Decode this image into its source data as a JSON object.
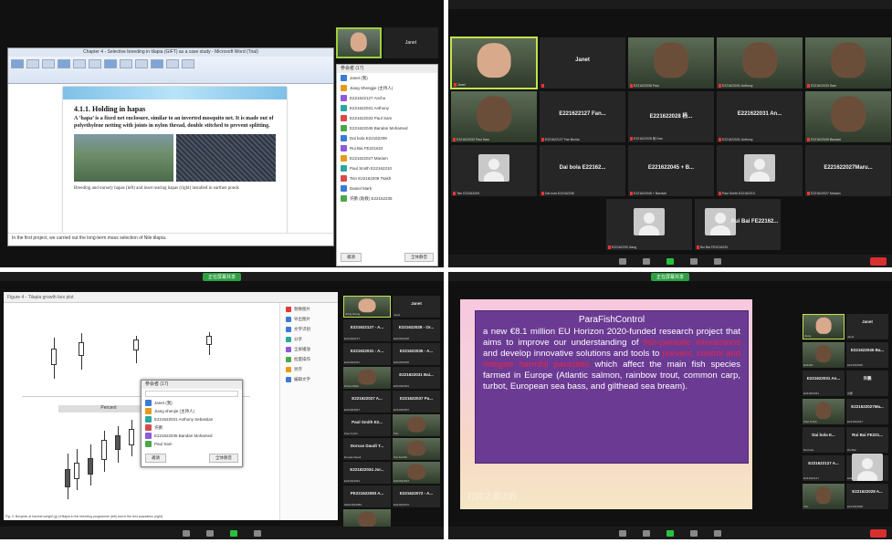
{
  "q1": {
    "word_title": "Chapter 4 - Selective breeding in tilapia (GIFT) as a case study - Microsoft Word (Trial)",
    "doc_heading": "4.1.1. Holding in hapas",
    "doc_para": "A ‘hapa’ is a fixed net enclosure, similar to an inverted mosquito net. It is made out of polyethylene netting with joints in nylon thread, double stitched to prevent splitting.",
    "doc_caption": "Breeding and nursery hapas (left) and inset rearing hapas (right) installed in earthen ponds",
    "doc_bottom": "In the first project, we carried out the long-term mass selection of Nile tilapia.",
    "participants_header": "参会者 (17)",
    "cam_label": "Janet",
    "participants": [
      {
        "name": "Janet (我)",
        "color": "#3a7bd5"
      },
      {
        "name": "Jiang Shengjie (主持人)",
        "color": "#e59b1a"
      },
      {
        "name": "E221622127 Ancho",
        "color": "#8d5ad8"
      },
      {
        "name": "E221622031 Anthony",
        "color": "#2aa8a0"
      },
      {
        "name": "E221622033 Paul Sam",
        "color": "#d84a4a"
      },
      {
        "name": "E221622045 Bandari Mohamed",
        "color": "#4aa84a"
      },
      {
        "name": "Dai bola E22162208",
        "color": "#3a7bd5"
      },
      {
        "name": "Rui Bai FE221622",
        "color": "#8d5ad8"
      },
      {
        "name": "E221622027 Mariam",
        "color": "#e59b1a"
      },
      {
        "name": "Paul Smith E22162210",
        "color": "#2aa8a0"
      },
      {
        "name": "Tsin E22162209 Tsakh",
        "color": "#d84a4a"
      },
      {
        "name": "Daniel Mark",
        "color": "#3a7bd5"
      },
      {
        "name": "许鹏 (助教) E22162235",
        "color": "#4aa84a"
      }
    ],
    "invite_label": "邀请",
    "mute_all_label": "全体静音"
  },
  "q2": {
    "tiles": [
      {
        "name": "",
        "sub": "Janet",
        "video": true,
        "highlight": true,
        "skin": "light"
      },
      {
        "name": "Janet",
        "sub": "",
        "video": false
      },
      {
        "name": "",
        "sub": "E221622038 Paul",
        "video": true,
        "skin": "dark"
      },
      {
        "name": "",
        "sub": "E221622031 Anthony",
        "video": true,
        "skin": "dark"
      },
      {
        "name": "",
        "sub": "E221622033 Sam",
        "video": true,
        "skin": "dark"
      },
      {
        "name": "",
        "sub": "E221622033 Paul Sam",
        "video": true,
        "skin": "dark"
      },
      {
        "name": "E221622127 Fan...",
        "sub": "E221622127 Fan Bundo",
        "video": false
      },
      {
        "name": "E221622028 杨...",
        "sub": "E221622028 杨 Dan",
        "video": false
      },
      {
        "name": "E221622031 An...",
        "sub": "E221622031 Anthony",
        "video": false
      },
      {
        "name": "",
        "sub": "E221622045 Bandari",
        "video": true,
        "skin": "dark"
      },
      {
        "name": "",
        "sub": "Tsin E22162209",
        "video": false,
        "placeholder": true
      },
      {
        "name": "Dai bola E22162...",
        "sub": "Dai bola E22162208",
        "video": false
      },
      {
        "name": "E221622045 + B...",
        "sub": "E221622045 + Bandari",
        "video": false
      },
      {
        "name": "",
        "sub": "Paul Smith E22162210",
        "video": false,
        "placeholder": true
      },
      {
        "name": "E221622027Maru...",
        "sub": "E221622027 Mariam",
        "video": false
      },
      {
        "name": "",
        "sub": "E22162239 Jiang",
        "video": false,
        "placeholder": true
      },
      {
        "name": "Rui Bai FE22162...",
        "sub": "Rui Bai FE2216220",
        "video": false,
        "placeholder_small": true
      }
    ]
  },
  "q3": {
    "window_title": "Figure 4 - Tilapia growth box plot",
    "panel_label": "Percent",
    "caption": "Fig. 4: Boxplots of harvest weight (g) of tilapia in the breeding programme (left) and in the test population (right).",
    "dialog_title": "参会者 (17)",
    "dialog_rows": [
      {
        "name": "Janet (我)",
        "color": "#3a7bd5"
      },
      {
        "name": "Jiang shenjie (主持人)",
        "color": "#e59b1a"
      },
      {
        "name": "E221622031 Anthony Sebastian",
        "color": "#2aa8a0"
      },
      {
        "name": "许鹏",
        "color": "#d84a4a"
      },
      {
        "name": "E221622045 Bandari Mohamed",
        "color": "#8d5ad8"
      },
      {
        "name": "Paul Sam",
        "color": "#4aa84a"
      }
    ],
    "dialog_invite": "邀请",
    "dialog_mute": "全体静音",
    "right_panel": [
      {
        "label": "替换图片",
        "color": "#e03a3a"
      },
      {
        "label": "导出图片",
        "color": "#3a7bd5"
      },
      {
        "label": "文字识别",
        "color": "#3a7bd5"
      },
      {
        "label": "分享",
        "color": "#2aa8a0"
      },
      {
        "label": "全屏播放",
        "color": "#8d5ad8"
      },
      {
        "label": "批量操作",
        "color": "#4aa84a"
      },
      {
        "label": "另存",
        "color": "#e59b1a"
      },
      {
        "label": "编辑文字",
        "color": "#3a7bd5"
      }
    ],
    "side_tiles": [
      {
        "name": "",
        "sub": "Jiang sheng",
        "video": true,
        "skin": "light"
      },
      {
        "name": "Janet",
        "sub": "Janet"
      },
      {
        "name": "E221622127 - A...",
        "sub": "E221622127"
      },
      {
        "name": "E221622028 - Or...",
        "sub": "E221622028"
      },
      {
        "name": "E221622031 - A...",
        "sub": "E221622031"
      },
      {
        "name": "E221622035 - A...",
        "sub": "E221622035"
      },
      {
        "name": "",
        "sub": "Daniel Mark",
        "video": true,
        "skin": "dark"
      },
      {
        "name": "E221622031 Bai...",
        "sub": "E221622031"
      },
      {
        "name": "E221622027 A...",
        "sub": "E221622027"
      },
      {
        "name": "E221622037 Pa...",
        "sub": "E221622037"
      },
      {
        "name": "Paul Smith E2...",
        "sub": "Paul Smith"
      },
      {
        "name": "",
        "sub": "Tsin",
        "video": true,
        "skin": "dark"
      },
      {
        "name": "Dorcas Daudi T...",
        "sub": "Dorcas Daudi"
      },
      {
        "name": "",
        "sub": "Tsin E2216",
        "video": true,
        "skin": "dark"
      },
      {
        "name": "E221622034 Jor...",
        "sub": "E221622034"
      },
      {
        "name": "",
        "sub": "E221622037",
        "video": true,
        "skin": "dark"
      },
      {
        "name": "PE221622083 A...",
        "sub": "PE221622083"
      },
      {
        "name": "E221622072 - A...",
        "sub": "E221622072"
      },
      {
        "name": "",
        "sub": "E221622038",
        "video": true,
        "skin": "dark"
      }
    ],
    "top_pill": "正在屏幕共享"
  },
  "q4": {
    "slide_title": "ParaFishControl",
    "slide_text_1": "a new €8.1 million EU Horizon 2020-funded research project that aims to improve our understanding of ",
    "slide_hl_1": "fish-parasite interactions",
    "slide_text_2": " and develop innovative solutions and tools to ",
    "slide_hl_2": "prevent, control and mitigate harmful parasites",
    "slide_text_3": " which affect the main fish species farmed in Europe (Atlantic salmon, rainbow trout, common carp, turbot, European sea bass, and gilthead sea bream).",
    "slide_footer": "打印之源之的",
    "top_pill": "正在屏幕共享",
    "side_tiles": [
      {
        "name": "",
        "sub": "Jiang",
        "video": true,
        "skin": "light",
        "highlight": true
      },
      {
        "name": "Janet",
        "sub": "Janet"
      },
      {
        "name": "",
        "sub": "E22162",
        "video": true,
        "skin": "dark"
      },
      {
        "name": "E221622045 Ba...",
        "sub": "E221622045"
      },
      {
        "name": "E221622031 An...",
        "sub": "E221622031"
      },
      {
        "name": "许鹏",
        "sub": "许鹏"
      },
      {
        "name": "",
        "sub": "Paul Smith",
        "video": true,
        "skin": "dark"
      },
      {
        "name": "E221622027Ma...",
        "sub": "E221622027"
      },
      {
        "name": "Dai bola E...",
        "sub": "Dai bola"
      },
      {
        "name": "Rui Bai FE221...",
        "sub": "Rui Bai"
      },
      {
        "name": "E221622127 A...",
        "sub": "E221622127"
      },
      {
        "name": "",
        "sub": "E2216",
        "video": false,
        "placeholder": true
      },
      {
        "name": "",
        "sub": "Tsin",
        "video": true,
        "skin": "dark"
      },
      {
        "name": "E221622028 A...",
        "sub": "E221622028"
      }
    ]
  }
}
